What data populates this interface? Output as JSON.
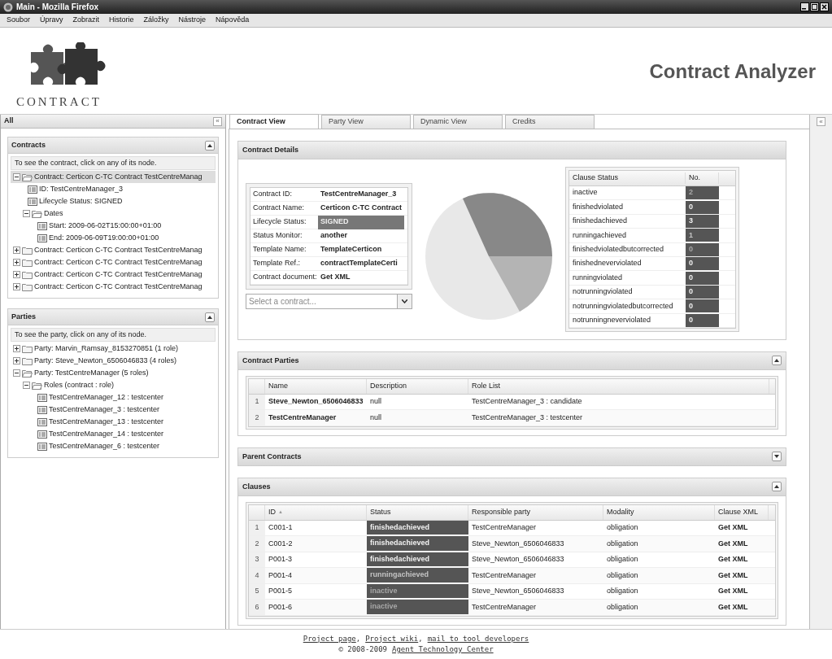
{
  "window": {
    "title": "Main - Mozilla Firefox"
  },
  "menu": [
    "Soubor",
    "Úpravy",
    "Zobrazit",
    "Historie",
    "Záložky",
    "Nástroje",
    "Nápověda"
  ],
  "header": {
    "logo_text": "CONTRACT",
    "title": "Contract Analyzer"
  },
  "sidebar": {
    "title": "All",
    "collapse": "«",
    "panels": [
      {
        "title": "Contracts",
        "collapsed": false,
        "hint": "To see the contract, click on any of its node.",
        "tree": [
          {
            "label": "Contract: Certicon C-TC Contract TestCentreManag",
            "kind": "folder",
            "expanded": true,
            "selected": true,
            "children": [
              {
                "label": "ID: TestCentreManager_3",
                "kind": "leaf",
                "selected": false
              },
              {
                "label": "Lifecycle Status: SIGNED",
                "kind": "leaf",
                "selected": false
              },
              {
                "label": "Dates",
                "kind": "folder",
                "expanded": true,
                "selected": false,
                "children": [
                  {
                    "label": "Start: 2009-06-02T15:00:00+01:00",
                    "kind": "leaf",
                    "selected": false
                  },
                  {
                    "label": "End: 2009-06-09T19:00:00+01:00",
                    "kind": "leaf",
                    "selected": false
                  }
                ]
              }
            ]
          },
          {
            "label": "Contract: Certicon C-TC Contract TestCentreManag",
            "kind": "folder",
            "expanded": false,
            "selected": false
          },
          {
            "label": "Contract: Certicon C-TC Contract TestCentreManag",
            "kind": "folder",
            "expanded": false,
            "selected": false
          },
          {
            "label": "Contract: Certicon C-TC Contract TestCentreManag",
            "kind": "folder",
            "expanded": false,
            "selected": false
          },
          {
            "label": "Contract: Certicon C-TC Contract TestCentreManag",
            "kind": "folder",
            "expanded": false,
            "selected": false
          }
        ]
      },
      {
        "title": "Parties",
        "collapsed": false,
        "hint": "To see the party, click on any of its node.",
        "tree": [
          {
            "label": "Party: Marvin_Ramsay_8153270851 (1 role)",
            "kind": "folder",
            "expanded": false,
            "selected": false
          },
          {
            "label": "Party: Steve_Newton_6506046833 (4 roles)",
            "kind": "folder",
            "expanded": false,
            "selected": false
          },
          {
            "label": "Party: TestCentreManager (5 roles)",
            "kind": "folder",
            "expanded": true,
            "selected": false,
            "children": [
              {
                "label": "Roles (contract : role)",
                "kind": "folder",
                "expanded": true,
                "selected": false,
                "children": [
                  {
                    "label": "TestCentreManager_12 : testcenter",
                    "kind": "leaf",
                    "selected": false
                  },
                  {
                    "label": "TestCentreManager_3 : testcenter",
                    "kind": "leaf",
                    "selected": false
                  },
                  {
                    "label": "TestCentreManager_13 : testcenter",
                    "kind": "leaf",
                    "selected": false
                  },
                  {
                    "label": "TestCentreManager_14 : testcenter",
                    "kind": "leaf",
                    "selected": false
                  },
                  {
                    "label": "TestCentreManager_6 : testcenter",
                    "kind": "leaf",
                    "selected": false
                  }
                ]
              }
            ]
          }
        ]
      }
    ]
  },
  "tabs": [
    {
      "label": "Contract View",
      "selected": true
    },
    {
      "label": "Party View",
      "selected": false
    },
    {
      "label": "Dynamic View",
      "selected": false
    },
    {
      "label": "Credits",
      "selected": false
    }
  ],
  "right_panel": {
    "expand": "«"
  },
  "contract_details": {
    "title": "Contract Details",
    "collapsed": false,
    "fields": [
      {
        "label": "Contract ID:",
        "value": "TestCentreManager_3",
        "highlighted": false
      },
      {
        "label": "Contract Name:",
        "value": "Certicon C-TC Contract",
        "highlighted": false
      },
      {
        "label": "Lifecycle Status:",
        "value": "SIGNED",
        "highlighted": true
      },
      {
        "label": "Status Monitor:",
        "value": "another",
        "highlighted": false
      },
      {
        "label": "Template Name:",
        "value": "TemplateCerticon",
        "highlighted": false
      },
      {
        "label": "Template Ref.:",
        "value": "contractTemplateCerti",
        "highlighted": false
      },
      {
        "label": "Contract document:",
        "value": "Get XML",
        "highlighted": false
      }
    ],
    "select": {
      "placeholder": "Select a contract..."
    },
    "clause_status": {
      "columns": [
        "Clause Status",
        "No."
      ],
      "rows": [
        {
          "status": "inactive",
          "count": "2",
          "kind": "dim"
        },
        {
          "status": "finishedviolated",
          "count": "0",
          "kind": "bright"
        },
        {
          "status": "finishedachieved",
          "count": "3",
          "kind": "bright"
        },
        {
          "status": "runningachieved",
          "count": "1",
          "kind": "medium"
        },
        {
          "status": "finishedviolatedbutcorrected",
          "count": "0",
          "kind": "dim"
        },
        {
          "status": "finishedneverviolated",
          "count": "0",
          "kind": "bright"
        },
        {
          "status": "runningviolated",
          "count": "0",
          "kind": "bright"
        },
        {
          "status": "notrunningviolated",
          "count": "0",
          "kind": "bright"
        },
        {
          "status": "notrunningviolatedbutcorrected",
          "count": "0",
          "kind": "bright"
        },
        {
          "status": "notrunningneverviolated",
          "count": "0",
          "kind": "bright"
        }
      ]
    }
  },
  "contract_parties": {
    "title": "Contract Parties",
    "collapsed": false,
    "columns": [
      "Name",
      "Description",
      "Role List"
    ],
    "rows": [
      {
        "number": "1",
        "name": "Steve_Newton_6506046833",
        "description": "null",
        "roles": "TestCentreManager_3 : candidate"
      },
      {
        "number": "2",
        "name": "TestCentreManager",
        "description": "null",
        "roles": "TestCentreManager_3 : testcenter"
      }
    ]
  },
  "parent_contracts": {
    "title": "Parent Contracts",
    "collapsed": true
  },
  "clauses": {
    "title": "Clauses",
    "collapsed": false,
    "columns": [
      "ID",
      "Status",
      "Responsible party",
      "Modality",
      "Clause XML"
    ],
    "sort_mark": "▲",
    "rows": [
      {
        "number": "1",
        "id": "C001-1",
        "status": "finishedachieved",
        "kind": "bright",
        "party": "TestCentreManager",
        "modality": "obligation",
        "xml": "Get XML"
      },
      {
        "number": "2",
        "id": "C001-2",
        "status": "finishedachieved",
        "kind": "bright",
        "party": "Steve_Newton_6506046833",
        "modality": "obligation",
        "xml": "Get XML"
      },
      {
        "number": "3",
        "id": "P001-3",
        "status": "finishedachieved",
        "kind": "bright",
        "party": "Steve_Newton_6506046833",
        "modality": "obligation",
        "xml": "Get XML"
      },
      {
        "number": "4",
        "id": "P001-4",
        "status": "runningachieved",
        "kind": "medium",
        "party": "TestCentreManager",
        "modality": "obligation",
        "xml": "Get XML"
      },
      {
        "number": "5",
        "id": "P001-5",
        "status": "inactive",
        "kind": "dim",
        "party": "Steve_Newton_6506046833",
        "modality": "obligation",
        "xml": "Get XML"
      },
      {
        "number": "6",
        "id": "P001-6",
        "status": "inactive",
        "kind": "dim",
        "party": "TestCentreManager",
        "modality": "obligation",
        "xml": "Get XML"
      }
    ]
  },
  "footer": {
    "links": [
      "Project page",
      "Project wiki",
      "mail to tool developers"
    ],
    "separators": [
      ",",
      ","
    ],
    "copyright": "© 2008-2009",
    "org_link": "Agent Technology Center"
  }
}
